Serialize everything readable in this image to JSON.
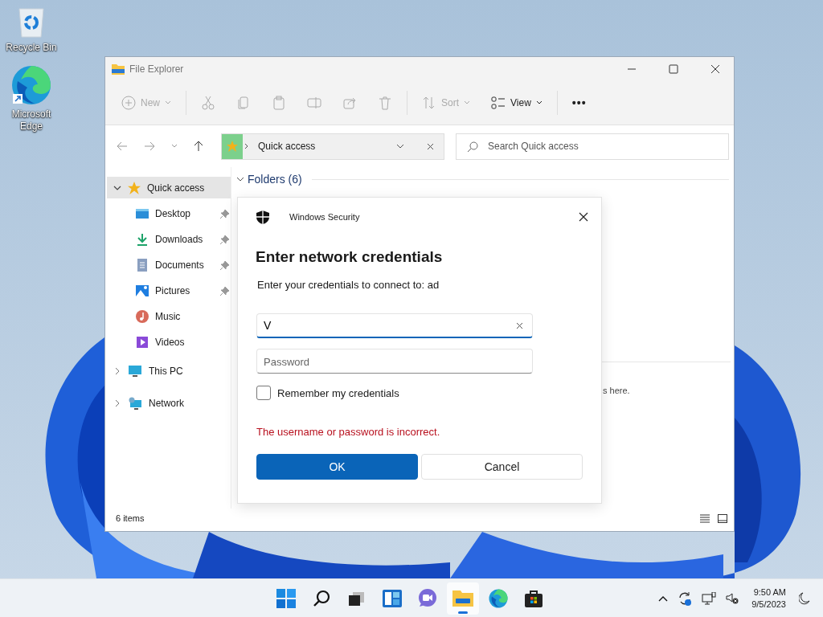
{
  "desktop_icons": [
    {
      "kind": "recycle",
      "label": "Recycle Bin"
    },
    {
      "kind": "edge",
      "label": "Microsoft Edge"
    }
  ],
  "explorer": {
    "title": "File Explorer",
    "toolbar": [
      {
        "kind": "new",
        "label": "New",
        "disabled": true
      },
      {
        "kind": "cut",
        "disabled": true
      },
      {
        "kind": "copy",
        "disabled": true
      },
      {
        "kind": "paste",
        "disabled": true
      },
      {
        "kind": "rename",
        "disabled": true
      },
      {
        "kind": "share",
        "disabled": true
      },
      {
        "kind": "delete",
        "disabled": true
      },
      {
        "kind": "sort",
        "label": "Sort",
        "disabled": true
      },
      {
        "kind": "view",
        "label": "View",
        "disabled": false
      },
      {
        "kind": "more",
        "label": "•••",
        "disabled": false
      }
    ],
    "address": "Quick access",
    "search": {
      "placeholder": "Search Quick access"
    },
    "sidebar": [
      {
        "kind": "star",
        "label": "Quick access",
        "expanded": true,
        "selected": true,
        "children": [
          {
            "kind": "desktop",
            "label": "Desktop",
            "pinned": true,
            "selected": false
          },
          {
            "kind": "downloads",
            "label": "Downloads",
            "pinned": true,
            "selected": false
          },
          {
            "kind": "documents",
            "label": "Documents",
            "pinned": true,
            "selected": false
          },
          {
            "kind": "pictures",
            "label": "Pictures",
            "pinned": true,
            "selected": false
          },
          {
            "kind": "music",
            "label": "Music",
            "pinned": false,
            "selected": false
          },
          {
            "kind": "videos",
            "label": "Videos",
            "pinned": false,
            "selected": false
          }
        ]
      },
      {
        "kind": "pc",
        "label": "This PC",
        "expanded": false,
        "selected": false
      },
      {
        "kind": "network",
        "label": "Network",
        "expanded": false,
        "selected": false
      }
    ],
    "section": {
      "label": "Folders (6)",
      "expanded": true
    },
    "hint": "s here.",
    "status": "6 items"
  },
  "dialog": {
    "app": "Windows Security",
    "heading": "Enter network credentials",
    "message": "Enter your credentials to connect to: ad",
    "username": {
      "value": "V"
    },
    "password": {
      "placeholder": "Password"
    },
    "remember": {
      "label": "Remember my credentials",
      "checked": false
    },
    "error": "The username or password is incorrect.",
    "buttons": [
      {
        "kind": "primary",
        "label": "OK"
      },
      {
        "kind": "secondary",
        "label": "Cancel"
      }
    ]
  },
  "taskbar": {
    "apps": [
      {
        "kind": "start",
        "active": false
      },
      {
        "kind": "search",
        "active": false
      },
      {
        "kind": "taskview",
        "active": false
      },
      {
        "kind": "widgets",
        "active": false
      },
      {
        "kind": "chat",
        "active": false
      },
      {
        "kind": "explorer",
        "active": true
      },
      {
        "kind": "edge",
        "active": false
      },
      {
        "kind": "store",
        "active": false
      }
    ],
    "time": "9:50 AM",
    "date": "9/5/2023"
  }
}
